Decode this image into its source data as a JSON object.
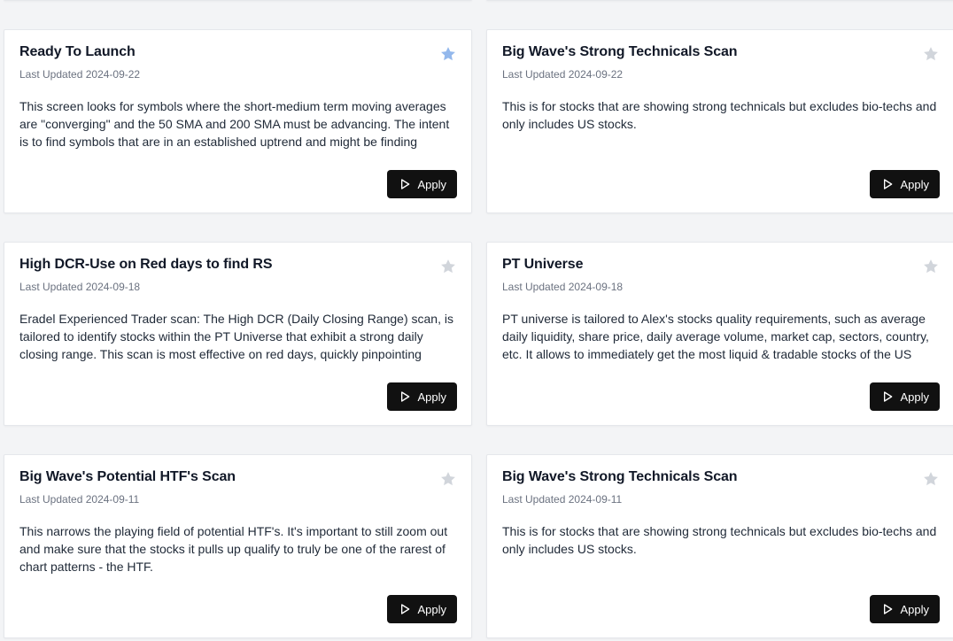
{
  "apply_label": "Apply",
  "updated_prefix": "Last Updated",
  "colors": {
    "star_active": "#93b8ec",
    "star_inactive": "#d1d5db",
    "button_bg": "#111111"
  },
  "cards": [
    {
      "title": "Ready To Launch",
      "last_updated": "Last Updated 2024-09-22",
      "description": "This screen looks for symbols where the short-medium term moving averages are \"converging\" and the 50 SMA and 200 SMA must be advancing. The intent is to find symbols that are in an established uptrend and might be finding support around KMAs.",
      "favorite": true,
      "star_icon": "star-icon"
    },
    {
      "title": "Big Wave's Strong Technicals Scan",
      "last_updated": "Last Updated 2024-09-22",
      "description": "This is for stocks that are showing strong technicals but excludes bio-techs and only includes US stocks.",
      "favorite": false,
      "star_icon": "star-icon"
    },
    {
      "title": "High DCR-Use on Red days to find RS",
      "last_updated": "Last Updated 2024-09-18",
      "description": "Eradel Experienced Trader scan: The High DCR (Daily Closing Range) scan, is tailored to identify stocks within the PT Universe that exhibit a strong daily closing range. This scan is most effective on red days, quickly pinpointing stocks demonstrating the highest Relative Strength.",
      "favorite": false,
      "star_icon": "star-icon"
    },
    {
      "title": "PT Universe",
      "last_updated": "Last Updated 2024-09-18",
      "description": "PT universe is tailored to Alex's stocks quality requirements, such as average daily liquidity, share price, daily average volume, market cap, sectors, country, etc. It allows to immediately get the most liquid & tradable stocks of the US market.",
      "favorite": false,
      "star_icon": "star-icon"
    },
    {
      "title": "Big Wave's Potential HTF's Scan",
      "last_updated": "Last Updated 2024-09-11",
      "description": "This narrows the playing field of potential HTF's. It's important to still zoom out and make sure that the stocks it pulls up qualify to truly be one of the rarest of chart patterns - the HTF.",
      "favorite": false,
      "star_icon": "star-icon"
    },
    {
      "title": "Big Wave's Strong Technicals Scan",
      "last_updated": "Last Updated 2024-09-11",
      "description": "This is for stocks that are showing strong technicals but excludes bio-techs and only includes US stocks.",
      "favorite": false,
      "star_icon": "star-icon"
    }
  ]
}
